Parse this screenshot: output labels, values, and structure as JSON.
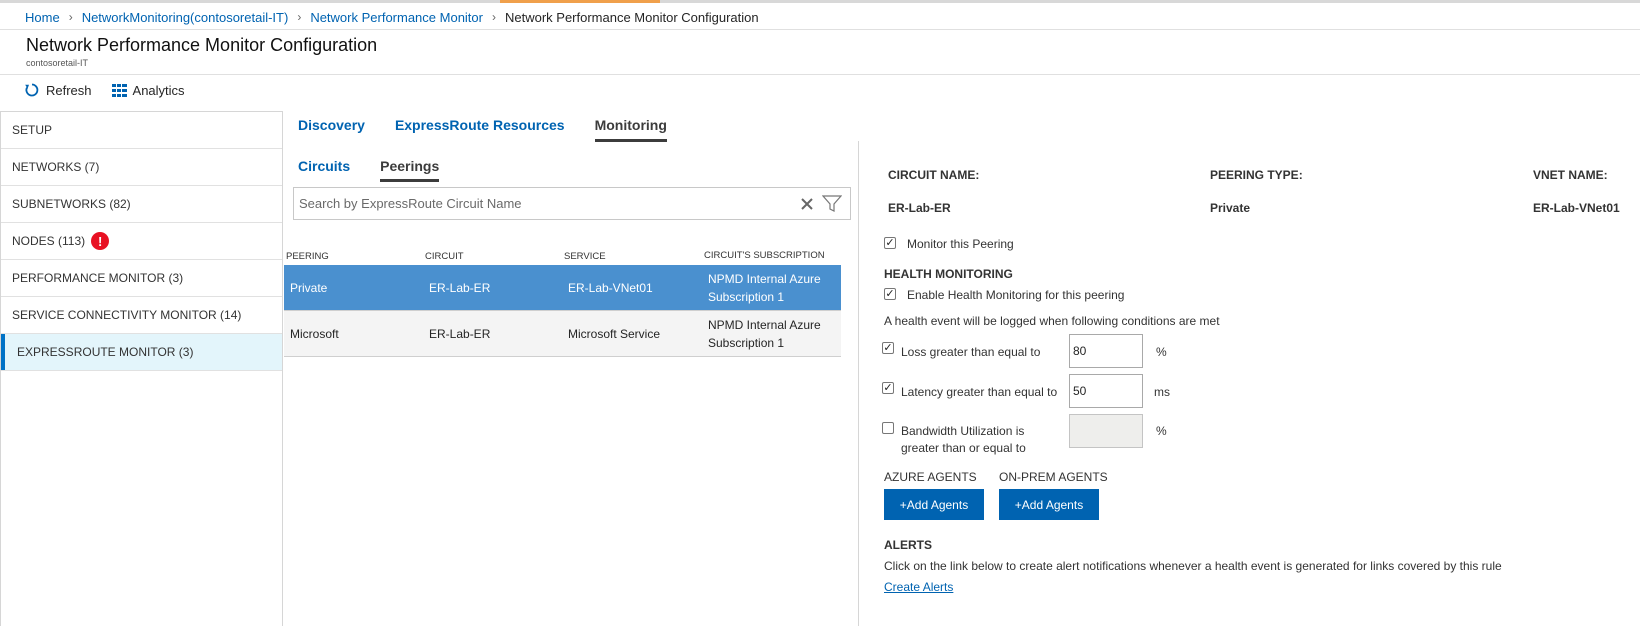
{
  "breadcrumb": {
    "home": "Home",
    "workspace": "NetworkMonitoring(contosoretail-IT)",
    "npm": "Network Performance Monitor",
    "current": "Network Performance Monitor Configuration"
  },
  "header": {
    "title": "Network Performance Monitor Configuration",
    "subtitle": "contosoretail-IT"
  },
  "toolbar": {
    "refresh": "Refresh",
    "analytics": "Analytics"
  },
  "sidebar": {
    "items": [
      {
        "label": "SETUP"
      },
      {
        "label": "NETWORKS (7)"
      },
      {
        "label": "SUBNETWORKS (82)"
      },
      {
        "label": "NODES (113)"
      },
      {
        "label": "PERFORMANCE MONITOR (3)"
      },
      {
        "label": "SERVICE CONNECTIVITY MONITOR (14)"
      },
      {
        "label": "EXPRESSROUTE MONITOR (3)"
      }
    ],
    "error_glyph": "!"
  },
  "tabs": {
    "discovery": "Discovery",
    "resources": "ExpressRoute Resources",
    "monitoring": "Monitoring"
  },
  "subtabs": {
    "circuits": "Circuits",
    "peerings": "Peerings"
  },
  "search": {
    "placeholder": "Search by ExpressRoute Circuit Name",
    "value": ""
  },
  "table": {
    "headers": {
      "peering": "PEERING",
      "circuit": "CIRCUIT",
      "service": "SERVICE",
      "subscription": "CIRCUIT'S SUBSCRIPTION"
    },
    "rows": [
      {
        "peering": "Private",
        "circuit": "ER-Lab-ER",
        "service": "ER-Lab-VNet01",
        "subscription": "NPMD Internal Azure Subscription 1"
      },
      {
        "peering": "Microsoft",
        "circuit": "ER-Lab-ER",
        "service": "Microsoft Service",
        "subscription": "NPMD Internal Azure Subscription 1"
      }
    ]
  },
  "detail": {
    "circuit_name_label": "CIRCUIT NAME:",
    "circuit_name": "ER-Lab-ER",
    "peering_type_label": "PEERING TYPE:",
    "peering_type": "Private",
    "vnet_name_label": "VNET NAME:",
    "vnet_name": "ER-Lab-VNet01",
    "monitor_peering": "Monitor this Peering",
    "health_heading": "HEALTH MONITORING",
    "enable_health": "Enable Health Monitoring for this peering",
    "health_note": "A health event will be logged when following conditions are met",
    "loss_label": "Loss greater than equal to",
    "loss_value": "80",
    "loss_unit": "%",
    "latency_label": "Latency greater than equal to",
    "latency_value": "50",
    "latency_unit": "ms",
    "bandwidth_label_1": "Bandwidth Utilization is",
    "bandwidth_label_2": "greater than or equal to",
    "bandwidth_unit": "%",
    "azure_agents": "AZURE AGENTS",
    "onprem_agents": "ON-PREM AGENTS",
    "add_agents": "+Add Agents",
    "alerts_heading": "ALERTS",
    "alerts_note": "Click on the link below to create alert notifications whenever a health event is generated for links covered by this rule",
    "create_alerts": "Create Alerts"
  },
  "checks": {
    "checked": "✓"
  },
  "colors": {
    "accent": "#0063b1",
    "selected_row": "#4a90cf",
    "active_side": "#e3f5fb",
    "error": "#e81123"
  }
}
